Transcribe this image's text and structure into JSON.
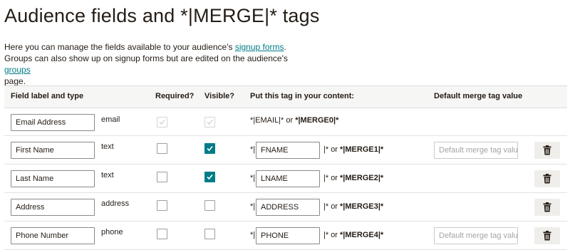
{
  "page": {
    "title": "Audience fields and *|MERGE|* tags",
    "desc_line1_pre": "Here you can manage the fields available to your audience's ",
    "desc_link1": "signup forms",
    "desc_line1_post": ".",
    "desc_line2_pre": "Groups can also show up on signup forms but are edited on the audience's ",
    "desc_link2": "groups",
    "desc_line3": "page."
  },
  "table": {
    "headers": {
      "label": "Field label and type",
      "required": "Required?",
      "visible": "Visible?",
      "tag": "Put this tag in your content:",
      "default": "Default merge tag value"
    },
    "default_placeholder": "Default merge tag value",
    "rows": [
      {
        "label": "Email Address",
        "type": "email",
        "required": true,
        "visible": true,
        "disabled": true,
        "tag_text": "*|EMAIL|* or ",
        "merge": "*|MERGE0|*"
      },
      {
        "label": "First Name",
        "type": "text",
        "required": false,
        "visible": true,
        "tag_prefix": "*|",
        "tag_value": "FNAME",
        "tag_suffix": "|* or ",
        "merge": "*|MERGE1|*",
        "default_value": ""
      },
      {
        "label": "Last Name",
        "type": "text",
        "required": false,
        "visible": true,
        "tag_prefix": "*|",
        "tag_value": "LNAME",
        "tag_suffix": "|* or ",
        "merge": "*|MERGE2|*",
        "default_value": ""
      },
      {
        "label": "Address",
        "type": "address",
        "required": false,
        "visible": false,
        "tag_prefix": "*|",
        "tag_value": "ADDRESS",
        "tag_suffix": "|* or ",
        "merge": "*|MERGE3|*"
      },
      {
        "label": "Phone Number",
        "type": "phone",
        "required": false,
        "visible": false,
        "tag_prefix": "*|",
        "tag_value": "PHONE",
        "tag_suffix": "|* or ",
        "merge": "*|MERGE4|*",
        "default_value": ""
      }
    ]
  },
  "colors": {
    "accent": "#007c89",
    "header_bg": "#f6f6f4",
    "delete_bg": "#efeeea"
  },
  "icons": {
    "delete": "trash-icon",
    "check": "check-icon"
  }
}
